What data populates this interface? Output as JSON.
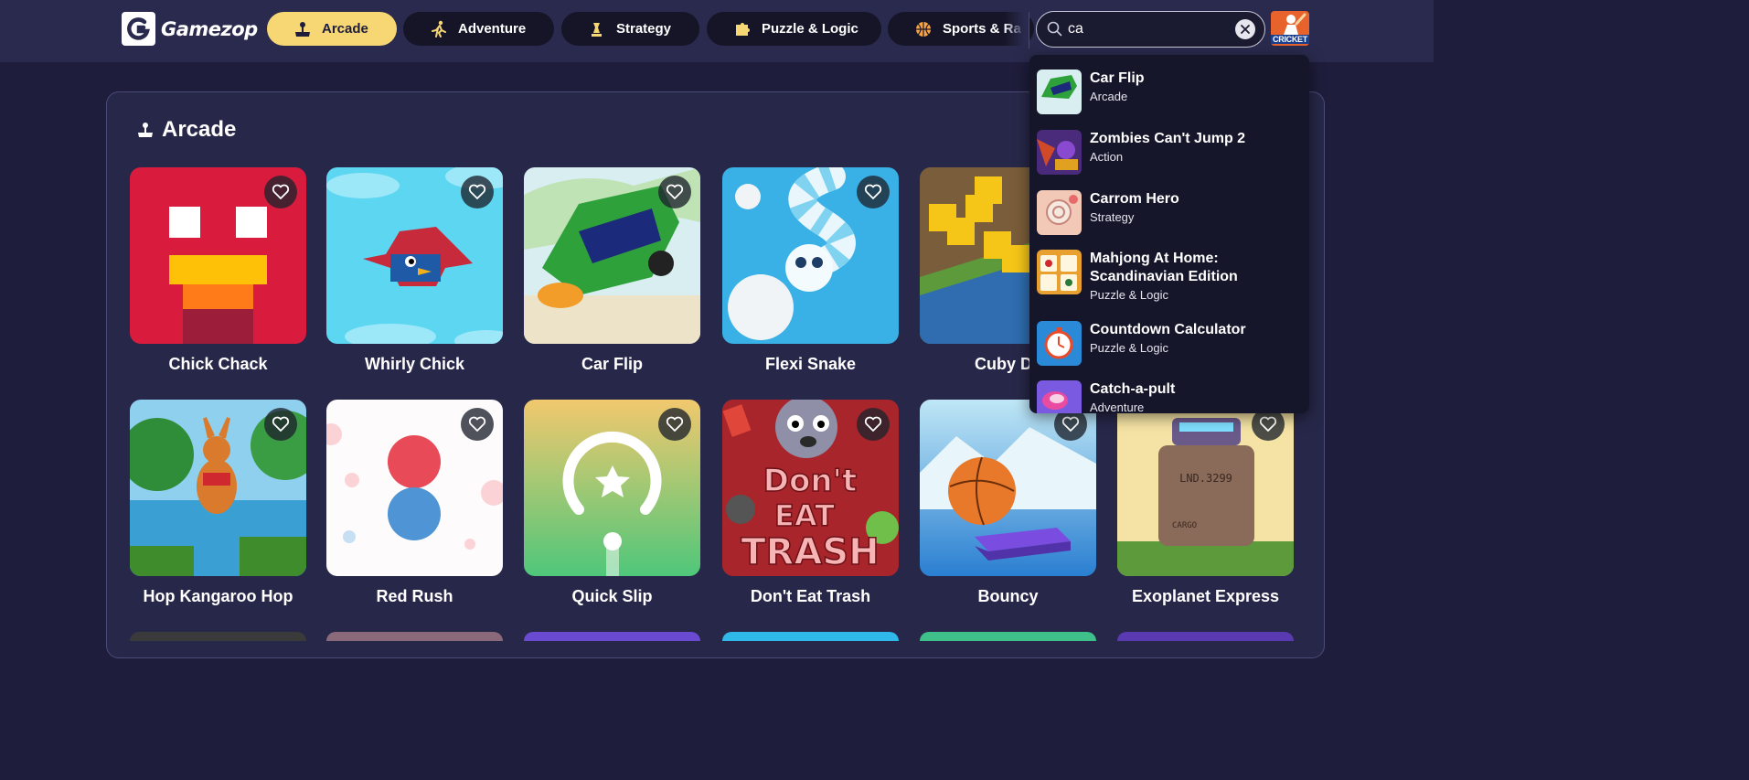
{
  "brand": {
    "name": "Gamezop"
  },
  "nav": {
    "tabs": [
      {
        "label": "Arcade",
        "icon": "joystick-icon",
        "active": true
      },
      {
        "label": "Adventure",
        "icon": "running-man-icon"
      },
      {
        "label": "Strategy",
        "icon": "chess-icon"
      },
      {
        "label": "Puzzle & Logic",
        "icon": "puzzle-piece-icon"
      },
      {
        "label": "Sports & Ra",
        "icon": "basketball-icon"
      }
    ]
  },
  "search": {
    "value": "ca"
  },
  "cricket": {
    "label": "CRICKET"
  },
  "section": {
    "title": "Arcade"
  },
  "games": [
    {
      "title": "Chick Chack"
    },
    {
      "title": "Whirly Chick"
    },
    {
      "title": "Car Flip"
    },
    {
      "title": "Flexi Snake"
    },
    {
      "title": "Cuby Da"
    },
    {
      "title": "Hop Kangaroo Hop"
    },
    {
      "title": "Red Rush"
    },
    {
      "title": "Quick Slip"
    },
    {
      "title": "Don't Eat Trash"
    },
    {
      "title": "Bouncy"
    },
    {
      "title": "Exoplanet Express"
    }
  ],
  "trash_art": {
    "line1": "Don't",
    "line2": "EAT",
    "line3": "TRASH"
  },
  "exo_art": {
    "plate": "LND.3299",
    "stamp": "CARGO"
  },
  "results": [
    {
      "name": "Car Flip",
      "category": "Arcade"
    },
    {
      "name": "Zombies Can't Jump 2",
      "category": "Action"
    },
    {
      "name": "Carrom Hero",
      "category": "Strategy"
    },
    {
      "name": "Mahjong At Home: Scandinavian Edition",
      "category": "Puzzle & Logic"
    },
    {
      "name": "Countdown Calculator",
      "category": "Puzzle & Logic"
    },
    {
      "name": "Catch-a-pult",
      "category": "Adventure"
    }
  ]
}
